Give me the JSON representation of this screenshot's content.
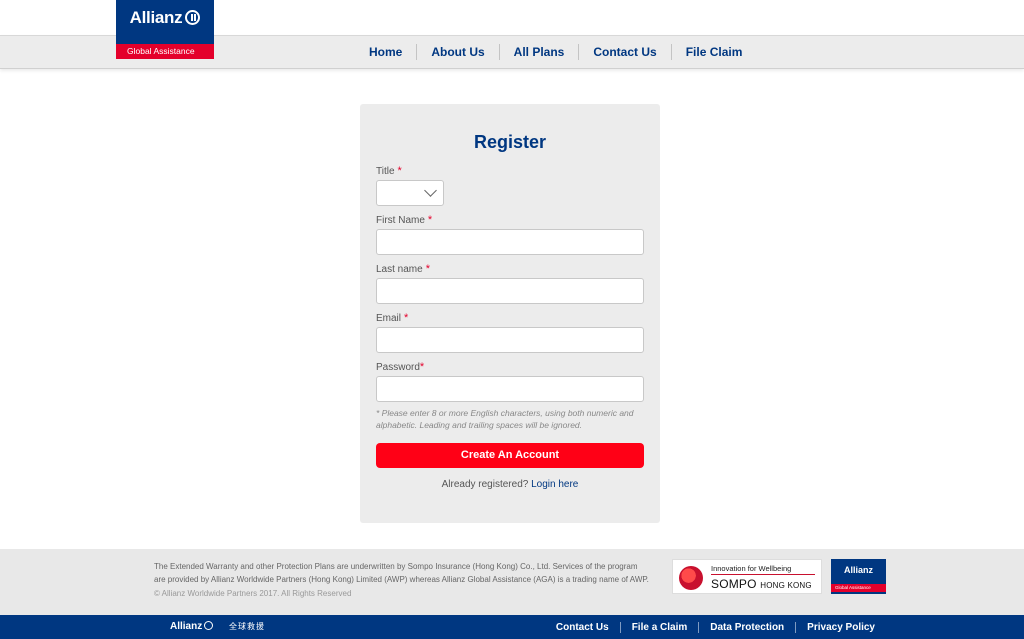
{
  "brand": {
    "name": "Allianz",
    "subtitle": "Global Assistance",
    "colors": {
      "primary": "#003781",
      "accent": "#e4002b",
      "button": "#ff0016"
    }
  },
  "nav": {
    "items": [
      {
        "label": "Home"
      },
      {
        "label": "About Us"
      },
      {
        "label": "All Plans"
      },
      {
        "label": "Contact Us"
      },
      {
        "label": "File Claim"
      }
    ]
  },
  "register": {
    "title": "Register",
    "required_mark": "*",
    "fields": {
      "title": {
        "label": "Title",
        "value": ""
      },
      "first_name": {
        "label": "First Name",
        "value": ""
      },
      "last_name": {
        "label": "Last name",
        "value": ""
      },
      "email": {
        "label": "Email",
        "value": ""
      },
      "password": {
        "label": "Password",
        "value": ""
      }
    },
    "password_hint": "* Please enter 8 or more English characters, using both numeric and alphabetic. Leading and trailing spaces will be ignored.",
    "submit_label": "Create An Account",
    "already_registered": "Already registered?",
    "login_link": "Login here"
  },
  "footer": {
    "disclaimer": "The Extended Warranty and other Protection Plans are underwritten by Sompo Insurance (Hong Kong) Co., Ltd. Services of the program are provided by Allianz Worldwide Partners (Hong Kong) Limited (AWP) whereas Allianz Global Assistance (AGA) is a trading name of AWP.",
    "copyright": "© Allianz Worldwide Partners 2017. All Rights Reserved",
    "sompo_tagline": "Innovation for Wellbeing",
    "sompo_name": "SOMPO",
    "sompo_region": "HONG KONG"
  },
  "bottom_bar": {
    "brand": "Allianz",
    "chinese_name": "全球救援",
    "links": [
      {
        "label": "Contact Us"
      },
      {
        "label": "File a Claim"
      },
      {
        "label": "Data Protection"
      },
      {
        "label": "Privacy Policy"
      }
    ]
  }
}
